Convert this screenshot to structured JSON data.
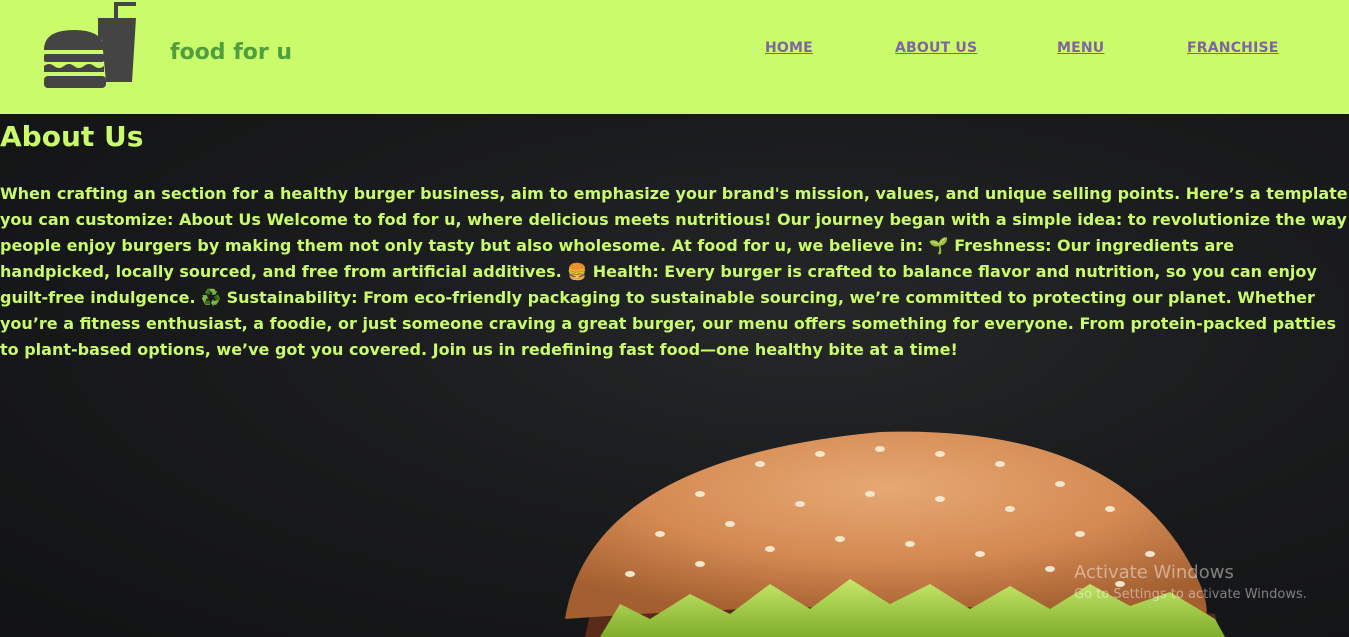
{
  "header": {
    "brand": "food for u",
    "logo_icon": "burger-and-drink-icon",
    "nav": [
      "HOME",
      "ABOUT US",
      "MENU",
      "FRANCHISE"
    ]
  },
  "about": {
    "title": "About Us",
    "body": "When crafting an section for a healthy burger business, aim to emphasize your brand's mission, values, and unique selling points. Here’s a template you can customize: About Us Welcome to fod for u, where delicious meets nutritious! Our journey began with a simple idea: to revolutionize the way people enjoy burgers by making them not only tasty but also wholesome. At food for u, we believe in: 🌱 Freshness: Our ingredients are handpicked, locally sourced, and free from artificial additives. 🍔 Health: Every burger is crafted to balance flavor and nutrition, so you can enjoy guilt-free indulgence. ♻️ Sustainability: From eco-friendly packaging to sustainable sourcing, we’re committed to protecting our planet. Whether you’re a fitness enthusiast, a foodie, or just someone craving a great burger, our menu offers something for everyone. From protein-packed patties to plant-based options, we’ve got you covered. Join us in redefining fast food—one healthy bite at a time!"
  },
  "watermark": {
    "line1": "Activate Windows",
    "line2": "Go to Settings to activate Windows."
  },
  "colors": {
    "header_bg": "#c9fb6a",
    "brand": "#4f9f3f",
    "nav": "#8064a2",
    "text": "#c9fb6a",
    "logo": "#444444"
  }
}
